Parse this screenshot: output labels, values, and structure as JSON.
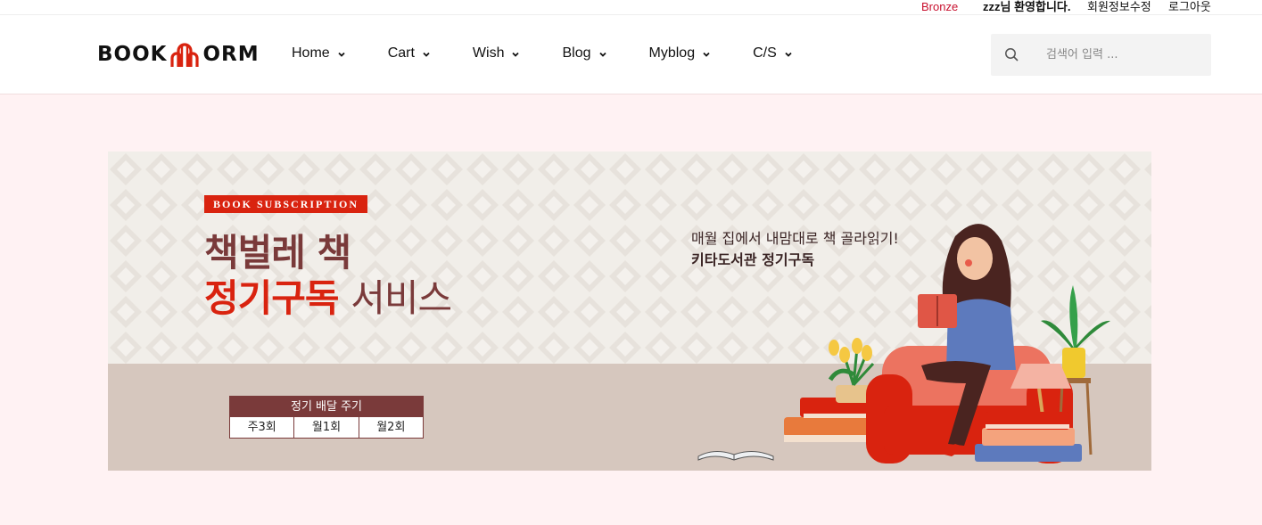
{
  "topbar": {
    "grade": "Bronze",
    "welcome": "zzz님 환영합니다.",
    "edit_profile": "회원정보수정",
    "logout": "로그아웃"
  },
  "header": {
    "logo_left": "BOOK",
    "logo_right": "ORM",
    "nav": [
      {
        "label": "Home"
      },
      {
        "label": "Cart"
      },
      {
        "label": "Wish"
      },
      {
        "label": "Blog"
      },
      {
        "label": "Myblog"
      },
      {
        "label": "C/S"
      }
    ],
    "search_placeholder": "검색어 입력 ..."
  },
  "banner": {
    "tag": "BOOK SUBSCRIPTION",
    "headline_line1": "책벌레 책",
    "headline_line2_red": "정기구독",
    "headline_line2_rest": "서비스",
    "tagline1": "매월 집에서 내맘대로 책 골라읽기!",
    "tagline2": "키타도서관 정기구독",
    "delivery_title": "정기 배달 주기",
    "delivery_options": [
      "주3회",
      "월1회",
      "월2회"
    ]
  },
  "colors": {
    "accent_red": "#d9230f",
    "brand_brown": "#7a3a3a",
    "grade_red": "#c8102e",
    "page_bg": "#fff2f3"
  }
}
